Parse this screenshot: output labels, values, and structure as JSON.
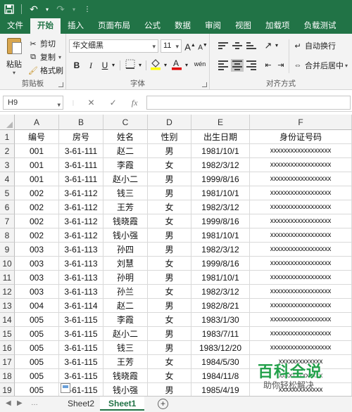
{
  "titlebar": {
    "save_icon": "save-icon",
    "undo_icon": "undo-icon",
    "redo_icon": "redo-icon",
    "customize_icon": "customize-qat-icon"
  },
  "tabs": [
    "文件",
    "开始",
    "插入",
    "页面布局",
    "公式",
    "数据",
    "审阅",
    "视图",
    "加载项",
    "负载测试"
  ],
  "active_tab": "开始",
  "clipboard": {
    "paste": "粘贴",
    "cut": "剪切",
    "copy": "复制",
    "format_painter": "格式刷",
    "group_label": "剪贴板"
  },
  "font": {
    "name": "华文细黑",
    "size": "11",
    "group_label": "字体",
    "bold": "B",
    "italic": "I",
    "underline": "U",
    "grow": "A",
    "shrink": "A",
    "font_color": "A"
  },
  "alignment": {
    "wrap_text": "自动换行",
    "merge_center": "合并后居中",
    "group_label": "对齐方式"
  },
  "formula_bar": {
    "name_box": "H9",
    "cancel": "✕",
    "enter": "✓",
    "fx": "fx",
    "value": ""
  },
  "columns": [
    "A",
    "B",
    "C",
    "D",
    "E",
    "F"
  ],
  "rows": [
    {
      "n": "1",
      "c": [
        "编号",
        "房号",
        "姓名",
        "性别",
        "出生日期",
        "身份证号码"
      ]
    },
    {
      "n": "2",
      "c": [
        "001",
        "3-61-111",
        "赵二",
        "男",
        "1981/10/1",
        "xxxxxxxxxxxxxxxxxx"
      ]
    },
    {
      "n": "3",
      "c": [
        "001",
        "3-61-111",
        "李霞",
        "女",
        "1982/3/12",
        "xxxxxxxxxxxxxxxxxx"
      ]
    },
    {
      "n": "4",
      "c": [
        "001",
        "3-61-111",
        "赵小二",
        "男",
        "1999/8/16",
        "xxxxxxxxxxxxxxxxxx"
      ]
    },
    {
      "n": "5",
      "c": [
        "002",
        "3-61-112",
        "钱三",
        "男",
        "1981/10/1",
        "xxxxxxxxxxxxxxxxxx"
      ]
    },
    {
      "n": "6",
      "c": [
        "002",
        "3-61-112",
        "王芳",
        "女",
        "1982/3/12",
        "xxxxxxxxxxxxxxxxxx"
      ]
    },
    {
      "n": "7",
      "c": [
        "002",
        "3-61-112",
        "钱晓霞",
        "女",
        "1999/8/16",
        "xxxxxxxxxxxxxxxxxx"
      ]
    },
    {
      "n": "8",
      "c": [
        "002",
        "3-61-112",
        "钱小强",
        "男",
        "1981/10/1",
        "xxxxxxxxxxxxxxxxxx"
      ]
    },
    {
      "n": "9",
      "c": [
        "003",
        "3-61-113",
        "孙四",
        "男",
        "1982/3/12",
        "xxxxxxxxxxxxxxxxxx"
      ]
    },
    {
      "n": "10",
      "c": [
        "003",
        "3-61-113",
        "刘慧",
        "女",
        "1999/8/16",
        "xxxxxxxxxxxxxxxxxx"
      ]
    },
    {
      "n": "11",
      "c": [
        "003",
        "3-61-113",
        "孙明",
        "男",
        "1981/10/1",
        "xxxxxxxxxxxxxxxxxx"
      ]
    },
    {
      "n": "12",
      "c": [
        "003",
        "3-61-113",
        "孙兰",
        "女",
        "1982/3/12",
        "xxxxxxxxxxxxxxxxxx"
      ]
    },
    {
      "n": "13",
      "c": [
        "004",
        "3-61-114",
        "赵二",
        "男",
        "1982/8/21",
        "xxxxxxxxxxxxxxxxxx"
      ]
    },
    {
      "n": "14",
      "c": [
        "005",
        "3-61-115",
        "李霞",
        "女",
        "1983/1/30",
        "xxxxxxxxxxxxxxxxxx"
      ]
    },
    {
      "n": "15",
      "c": [
        "005",
        "3-61-115",
        "赵小二",
        "男",
        "1983/7/11",
        "xxxxxxxxxxxxxxxxxx"
      ]
    },
    {
      "n": "16",
      "c": [
        "005",
        "3-61-115",
        "钱三",
        "男",
        "1983/12/20",
        "xxxxxxxxxxxxxxxxxx"
      ]
    },
    {
      "n": "17",
      "c": [
        "005",
        "3-61-115",
        "王芳",
        "女",
        "1984/5/30",
        "xxxxxxxxxxxxx"
      ]
    },
    {
      "n": "18",
      "c": [
        "005",
        "3-61-115",
        "钱晓霞",
        "女",
        "1984/11/8",
        "xxxxxxxxxxxxx"
      ]
    },
    {
      "n": "19",
      "c": [
        "005",
        "3-61-115",
        "钱小强",
        "男",
        "1985/4/19",
        "xxxxxxxxxxxxx"
      ]
    }
  ],
  "sheets": [
    "Sheet2",
    "Sheet1"
  ],
  "active_sheet": "Sheet1",
  "watermark": {
    "title": "百科全说",
    "subtitle": "助你轻松解决"
  },
  "colors": {
    "accent": "#217346",
    "ribbon_bg": "#f3f3f3",
    "highlight_yellow": "#ffff00",
    "font_red": "#e00000",
    "watermark_green": "#22a04a"
  }
}
